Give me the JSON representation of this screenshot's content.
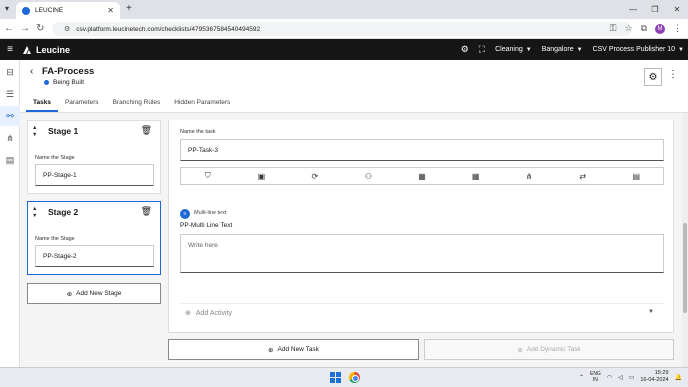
{
  "browser": {
    "tab_title": "LEUCINE",
    "url": "csv.platform.leucinetech.com/checklists/4795367584540494592",
    "profile_initial": "M"
  },
  "header": {
    "brand": "Leucine",
    "dropdowns": [
      "Cleaning",
      "Bangalore",
      "CSV Process Publisher 10"
    ]
  },
  "page": {
    "title": "FA-Process",
    "status": "Being Built",
    "tabs": [
      "Tasks",
      "Parameters",
      "Branching Rules",
      "Hidden Parameters"
    ],
    "active_tab": 0
  },
  "stages": [
    {
      "name": "Stage 1",
      "label": "Name the Stage",
      "value": "PP-Stage-1",
      "selected": false
    },
    {
      "name": "Stage 2",
      "label": "Name the Stage",
      "value": "PP-Stage-2",
      "selected": true
    }
  ],
  "add_stage_label": "Add New Stage",
  "task": {
    "name_label": "Name the task",
    "name_value": "PP-Task-3",
    "toolbar_icons": [
      "shield-icon",
      "image-icon",
      "recurrence-icon",
      "assign-user-icon",
      "calendar-icon",
      "schedule-icon",
      "hierarchy-icon",
      "branch-icon",
      "calendar-check-icon"
    ],
    "activity_type": "Multi-line text",
    "activity_name": "PP-Multi Line Text",
    "activity_placeholder": "Write here",
    "add_activity_label": "Add Activity"
  },
  "add_task_label": "Add New Task",
  "add_dynamic_task_label": "Add Dynamic Task",
  "taskbar": {
    "lang_line1": "ENG",
    "lang_line2": "IN",
    "time": "15:29",
    "date": "16-04-2024"
  },
  "colors": {
    "accent": "#1d68d8",
    "header_bg": "#161616"
  }
}
